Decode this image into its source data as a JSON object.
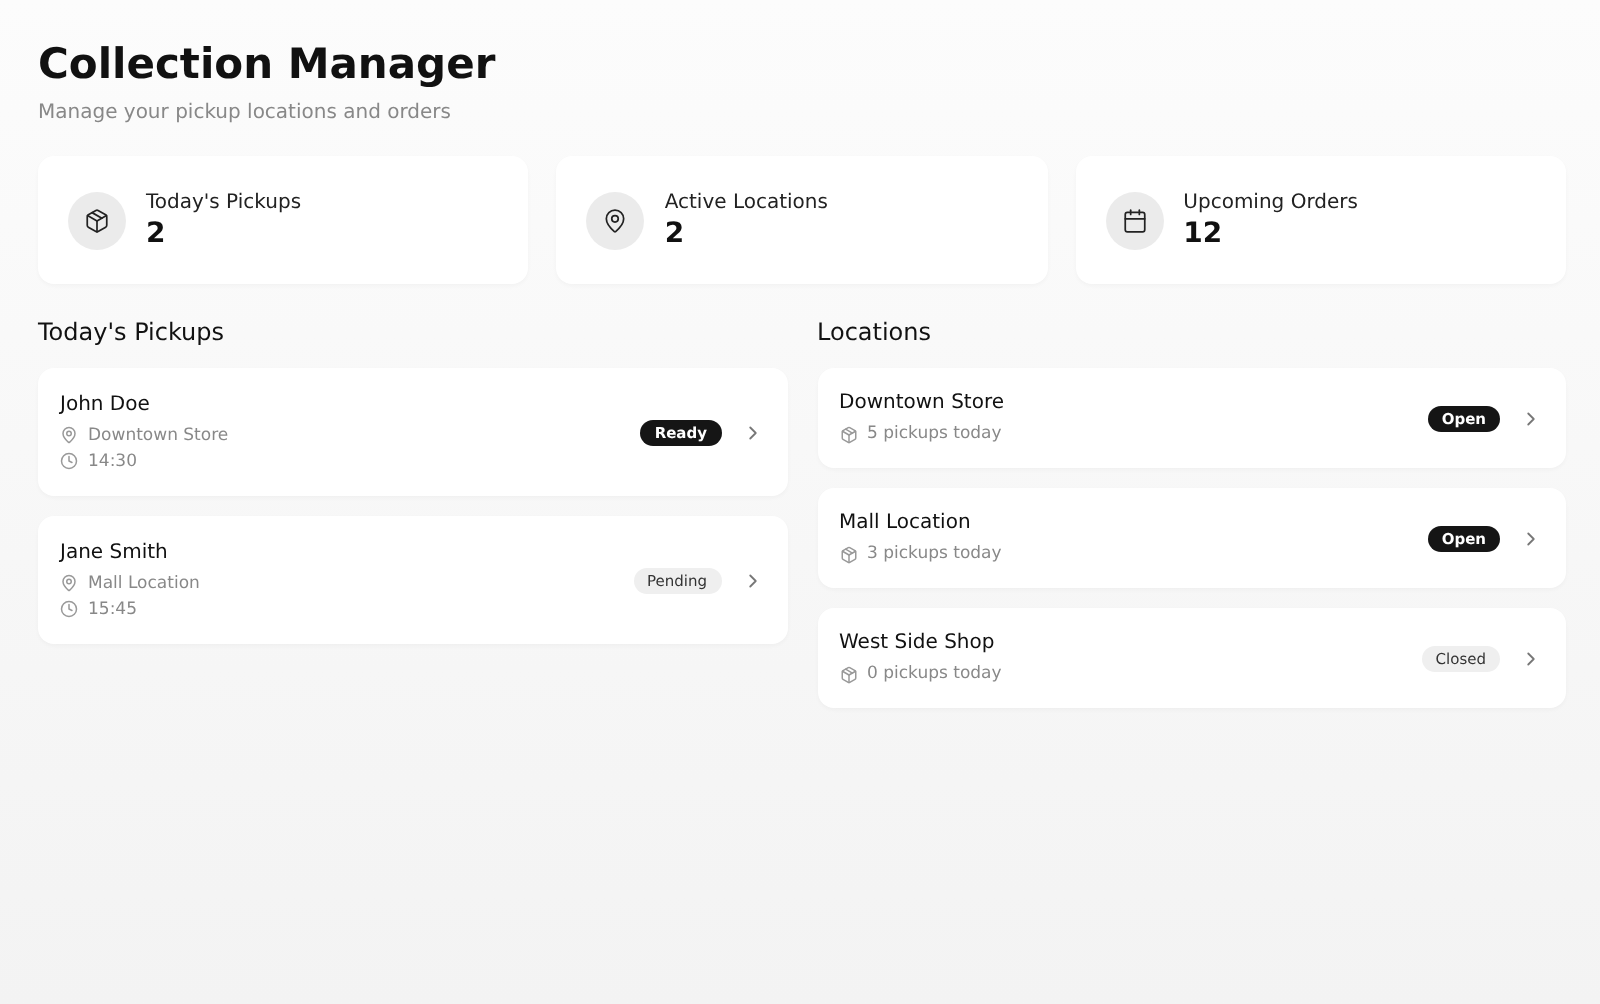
{
  "header": {
    "title": "Collection Manager",
    "subtitle": "Manage your pickup locations and orders"
  },
  "stats": [
    {
      "kind": "package",
      "label": "Today's Pickups",
      "value": "2"
    },
    {
      "kind": "pin",
      "label": "Active Locations",
      "value": "2"
    },
    {
      "kind": "calendar",
      "label": "Upcoming Orders",
      "value": "12"
    }
  ],
  "pickups": {
    "title": "Today's Pickups",
    "items": [
      {
        "name": "John Doe",
        "location": "Downtown Store",
        "time": "14:30",
        "status": "Ready",
        "kind": "dark"
      },
      {
        "name": "Jane Smith",
        "location": "Mall Location",
        "time": "15:45",
        "status": "Pending",
        "kind": "light"
      }
    ]
  },
  "locations": {
    "title": "Locations",
    "items": [
      {
        "name": "Downtown Store",
        "pickups": "5 pickups today",
        "status": "Open",
        "kind": "dark"
      },
      {
        "name": "Mall Location",
        "pickups": "3 pickups today",
        "status": "Open",
        "kind": "dark"
      },
      {
        "name": "West Side Shop",
        "pickups": "0 pickups today",
        "status": "Closed",
        "kind": "light"
      }
    ]
  }
}
